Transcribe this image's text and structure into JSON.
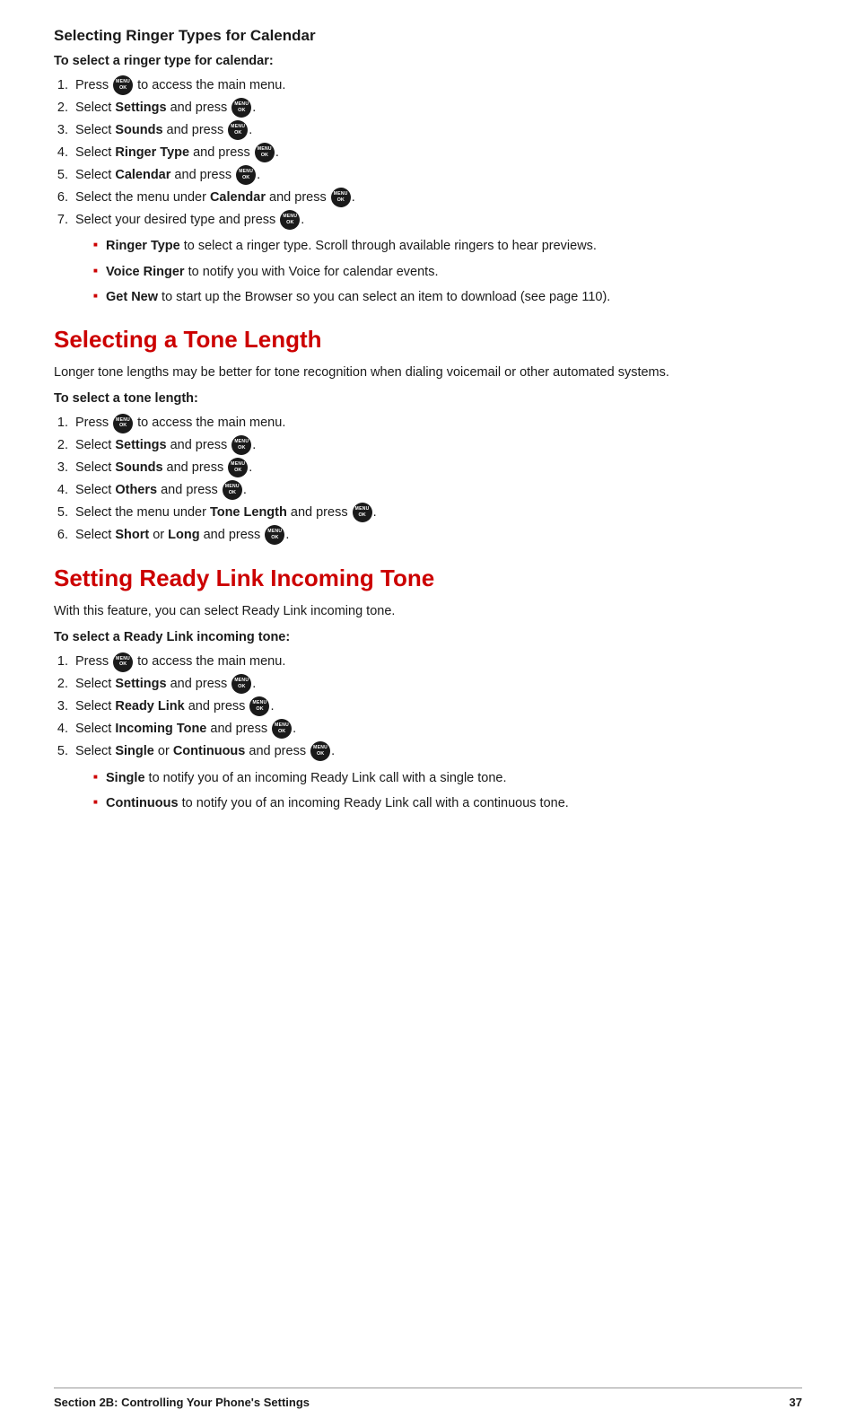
{
  "sections": {
    "ringer_types": {
      "heading": "Selecting Ringer Types for Calendar",
      "subheading": "To select a ringer type for calendar:",
      "steps": [
        "Press  to access the main menu.",
        "Select Settings and press .",
        "Select Sounds and press .",
        "Select Ringer Type and press .",
        "Select Calendar and press .",
        "Select the menu under Calendar and press .",
        "Select your desired type and press ."
      ],
      "bullets": [
        {
          "bold": "Ringer Type",
          "rest": " to select a ringer type. Scroll through available ringers to hear previews."
        },
        {
          "bold": "Voice Ringer",
          "rest": " to notify you with Voice for calendar events."
        },
        {
          "bold": "Get New",
          "rest": " to start up the Browser so you can select an item to download (see page 110)."
        }
      ]
    },
    "tone_length": {
      "heading": "Selecting a Tone Length",
      "description": "Longer tone lengths may be better for tone recognition when dialing voicemail or other automated systems.",
      "subheading": "To select a tone length:",
      "steps": [
        "Press  to access the main menu.",
        "Select Settings and press .",
        "Select Sounds and press .",
        "Select Others and press .",
        "Select the menu under Tone Length and press .",
        "Select Short or Long and press ."
      ]
    },
    "ready_link": {
      "heading": "Setting Ready Link Incoming Tone",
      "description": "With this feature, you can select Ready Link incoming tone.",
      "subheading": "To select a Ready Link incoming tone:",
      "steps": [
        "Press  to access the main menu.",
        "Select Settings and press .",
        "Select Ready Link and press .",
        "Select Incoming Tone and press .",
        "Select Single or Continuous and press ."
      ],
      "bullets": [
        {
          "bold": "Single",
          "rest": " to notify you of an incoming Ready Link call with a single tone."
        },
        {
          "bold": "Continuous",
          "rest": " to notify you of an incoming Ready Link call with a continuous tone."
        }
      ]
    }
  },
  "footer": {
    "left": "Section 2B: Controlling Your Phone's Settings",
    "right": "37"
  }
}
